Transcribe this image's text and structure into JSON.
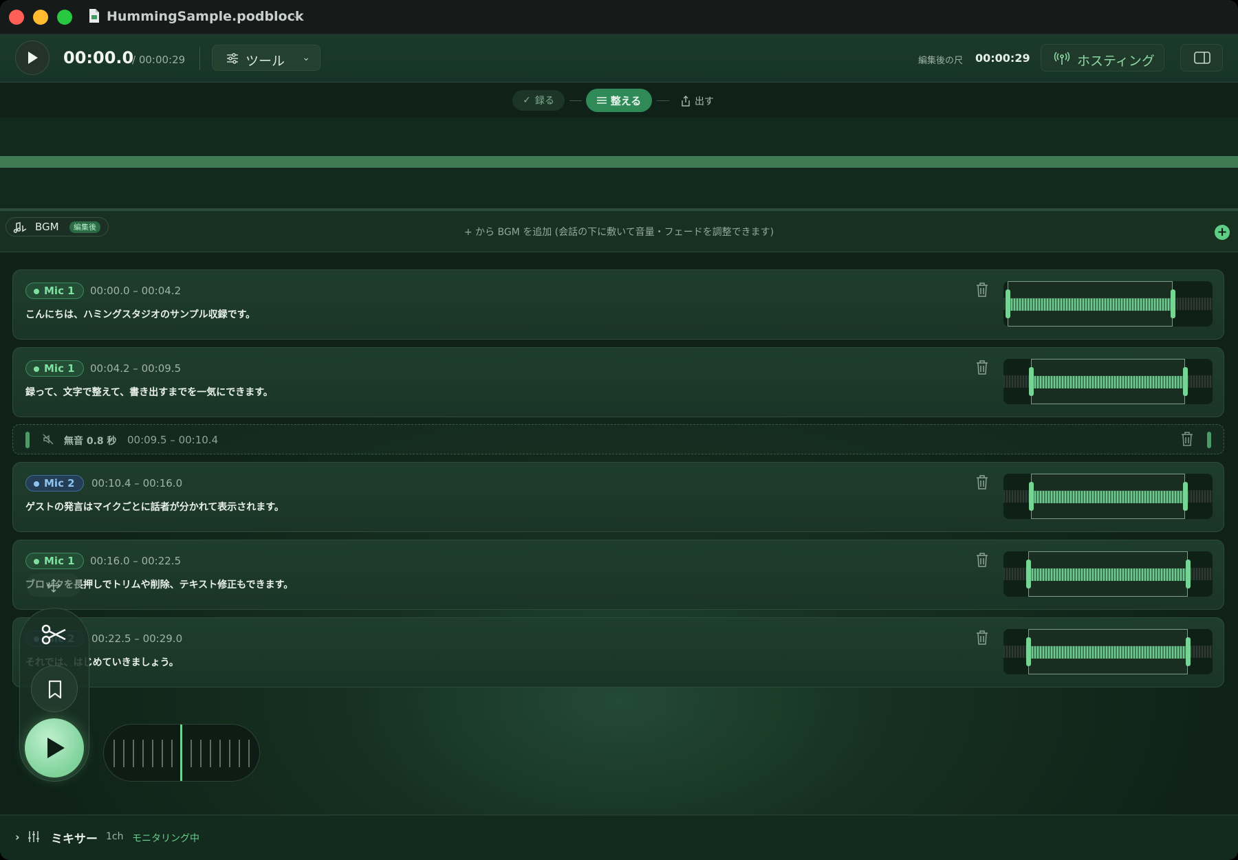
{
  "window": {
    "title": "HummingSample.podblock"
  },
  "toolbar": {
    "current_time": "00:00.0",
    "total_time": "/ 00:00:29",
    "tools_label": "ツール",
    "edited_label": "編集後の尺",
    "edited_time": "00:00:29",
    "hosting_label": "ホスティング"
  },
  "steps": {
    "record": "録る",
    "edit": "整える",
    "export": "出す"
  },
  "bgm": {
    "label": "BGM",
    "badge": "編集後",
    "hint": "+ から BGM を追加 (会話の下に敷いて音量・フェードを調整できます)",
    "add": "+"
  },
  "blocks": [
    {
      "mic": "Mic 1",
      "range": "00:00.0 – 00:04.2",
      "text": "こんにちは、ハミングスタジオのサンプル収録です。",
      "trim_start": 0.02,
      "trim_end": 0.81
    },
    {
      "mic": "Mic 1",
      "range": "00:04.2 – 00:09.5",
      "text": "録って、文字で整えて、書き出すまでを一気にできます。",
      "trim_start": 0.13,
      "trim_end": 0.87
    },
    {
      "mic": "Mic 2",
      "range": "00:10.4 – 00:16.0",
      "text": "ゲストの発言はマイクごとに話者が分かれて表示されます。",
      "trim_start": 0.13,
      "trim_end": 0.87
    },
    {
      "mic": "Mic 1",
      "range": "00:16.0 – 00:22.5",
      "text": "ブロックを長押しでトリムや削除、テキスト修正もできます。",
      "trim_start": 0.12,
      "trim_end": 0.88
    },
    {
      "mic": "Mic 2",
      "range": "00:22.5 – 00:29.0",
      "text": "それでは、はじめていきましょう。",
      "trim_start": 0.12,
      "trim_end": 0.88
    }
  ],
  "silence": {
    "label": "無音 0.8 秒",
    "range": "00:09.5 – 00:10.4"
  },
  "mixer": {
    "label": "ミキサー",
    "channels": "1ch",
    "status": "モニタリング中"
  },
  "colors": {
    "accent": "#2f8a58",
    "mic1": "#7fe0a0",
    "mic2": "#8cc3f1"
  }
}
